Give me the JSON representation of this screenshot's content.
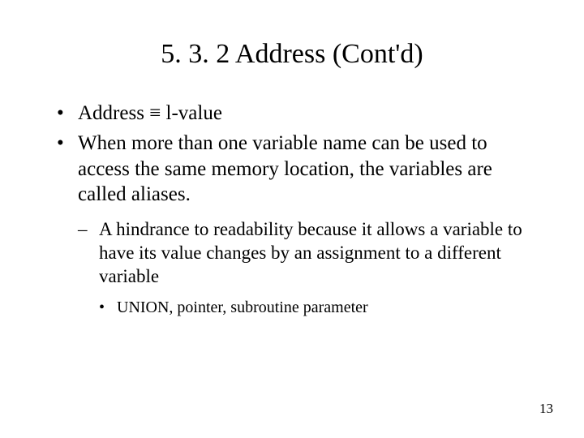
{
  "title": "5. 3. 2 Address (Cont'd)",
  "bullets": {
    "b1": "Address ≡ l-value",
    "b2": "When more than one variable name can be used to access the same memory location, the variables are called aliases.",
    "b2_sub1": "A hindrance to readability because it allows a variable to have its value changes by an assignment to a different variable",
    "b2_sub1_sub1": "UNION, pointer, subroutine parameter"
  },
  "page_number": "13"
}
